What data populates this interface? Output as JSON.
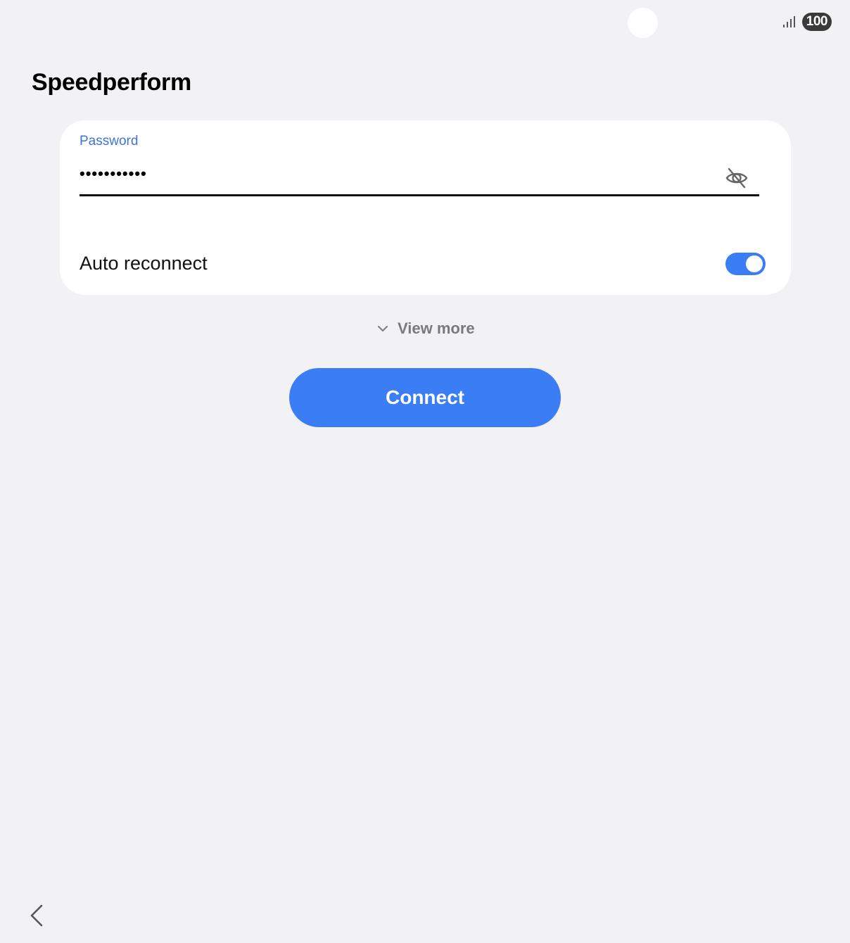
{
  "status_bar": {
    "battery": "100",
    "signal_icon": "signal-icon"
  },
  "page": {
    "title": "Speedperform"
  },
  "password": {
    "label": "Password",
    "value": "•••••••••••",
    "visibility_icon": "eye-off-icon"
  },
  "auto_reconnect": {
    "label": "Auto reconnect",
    "enabled": true
  },
  "view_more": {
    "label": "View more",
    "icon": "chevron-down-icon"
  },
  "connect": {
    "label": "Connect"
  },
  "navigation": {
    "back_icon": "back-icon"
  },
  "colors": {
    "accent": "#3b7df5",
    "label_blue": "#3e74d6",
    "background": "#f2f2f4",
    "card": "#ffffff"
  }
}
